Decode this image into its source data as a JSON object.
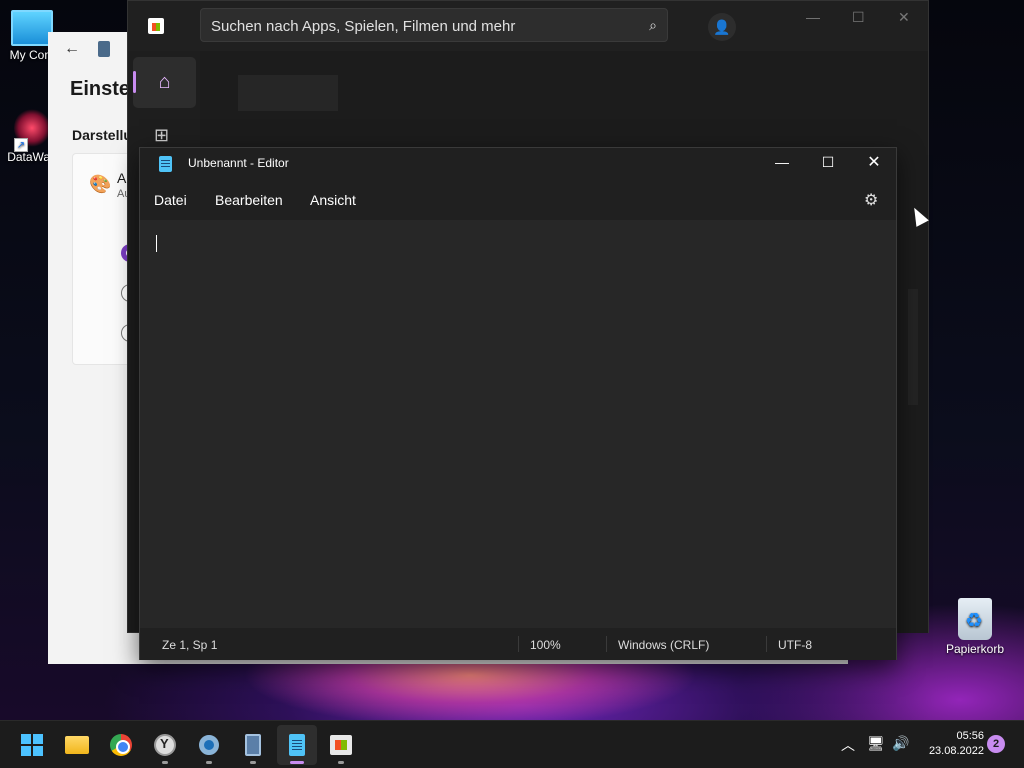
{
  "desktop": {
    "icons": [
      {
        "label": "My Com",
        "icon": "computer-icon"
      },
      {
        "label": "DataWag",
        "icon": "datawag-icon"
      },
      {
        "label": "Papierkorb",
        "icon": "recycle-bin-icon"
      }
    ]
  },
  "settings": {
    "title": "Einstel",
    "section": "Darstellu",
    "card_title": "A",
    "card_sub": "Au",
    "back_icon": "back-arrow-icon"
  },
  "store": {
    "search_placeholder": "Suchen nach Apps, Spielen, Filmen und mehr",
    "nav": [
      {
        "name": "home",
        "icon": "home-icon",
        "active": true
      },
      {
        "name": "apps",
        "icon": "apps-grid-icon"
      }
    ],
    "accent": "#c88cf0"
  },
  "notepad": {
    "title": "Unbenannt - Editor",
    "menu": {
      "file": "Datei",
      "edit": "Bearbeiten",
      "view": "Ansicht"
    },
    "content": "",
    "status": {
      "position": "Ze 1, Sp 1",
      "zoom": "100%",
      "line_ending": "Windows (CRLF)",
      "encoding": "UTF-8"
    }
  },
  "taskbar": {
    "apps": [
      {
        "name": "start",
        "icon": "windows-start-icon"
      },
      {
        "name": "file-explorer",
        "icon": "folder-icon",
        "running": false
      },
      {
        "name": "chrome",
        "icon": "chrome-icon",
        "running": false
      },
      {
        "name": "clock",
        "icon": "clock-app-icon",
        "running": true
      },
      {
        "name": "settings",
        "icon": "settings-gear-icon",
        "running": true
      },
      {
        "name": "calculator",
        "icon": "calculator-icon",
        "running": true
      },
      {
        "name": "notepad",
        "icon": "notepad-icon",
        "running": true,
        "active": true
      },
      {
        "name": "store",
        "icon": "store-icon",
        "running": true
      }
    ],
    "time": "05:56",
    "date": "23.08.2022",
    "notifications": "2"
  }
}
